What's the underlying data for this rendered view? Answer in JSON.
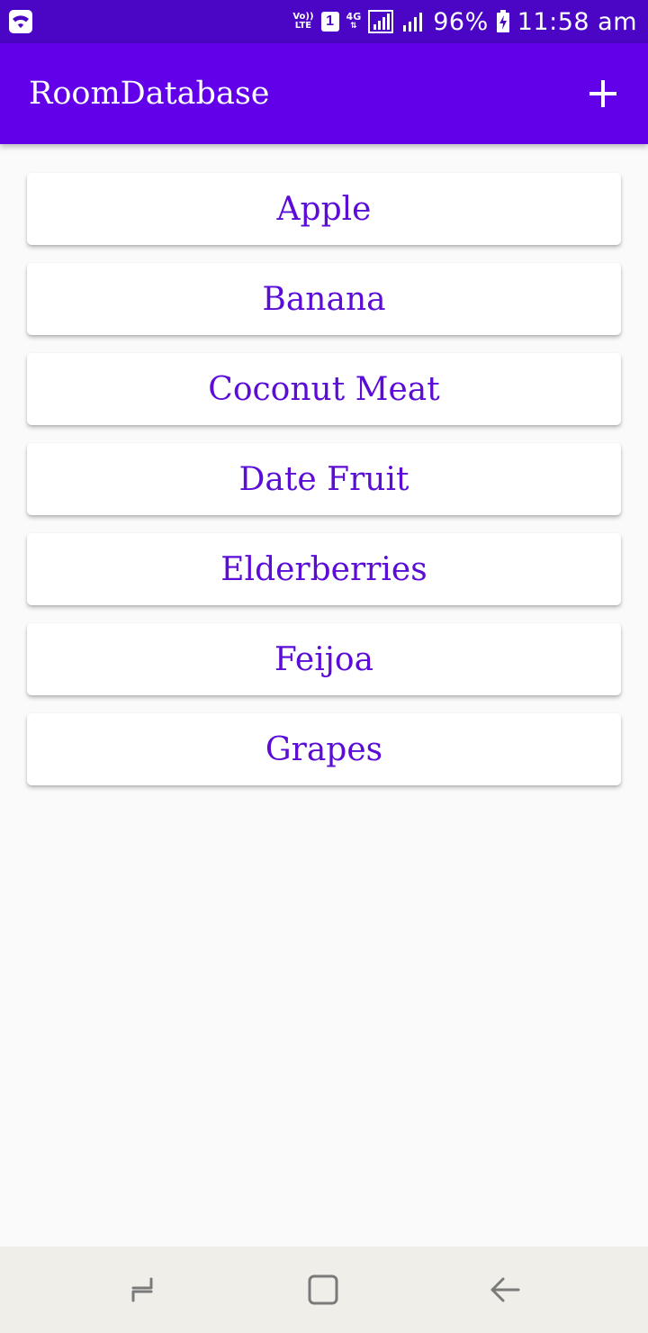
{
  "status_bar": {
    "volte_top": "Vo))",
    "volte_bottom": "LTE",
    "sim_slot": "1",
    "network": "4G",
    "battery_percent": "96%",
    "time": "11:58 am",
    "icons": [
      "wifi-icon",
      "signal-icon",
      "battery-charging-icon"
    ]
  },
  "app_bar": {
    "title": "RoomDatabase",
    "add_icon": "plus-icon",
    "color": "#6200ea"
  },
  "fruits": [
    {
      "name": "Apple"
    },
    {
      "name": "Banana"
    },
    {
      "name": "Coconut Meat"
    },
    {
      "name": "Date Fruit"
    },
    {
      "name": "Elderberries"
    },
    {
      "name": "Feijoa"
    },
    {
      "name": "Grapes"
    }
  ],
  "nav_bar": {
    "icons": [
      "recent-apps-icon",
      "home-icon",
      "back-icon"
    ]
  },
  "colors": {
    "status_bar": "#4a06c4",
    "accent": "#6200ea",
    "item_text": "#5b0cd6",
    "background": "#fafafa"
  }
}
